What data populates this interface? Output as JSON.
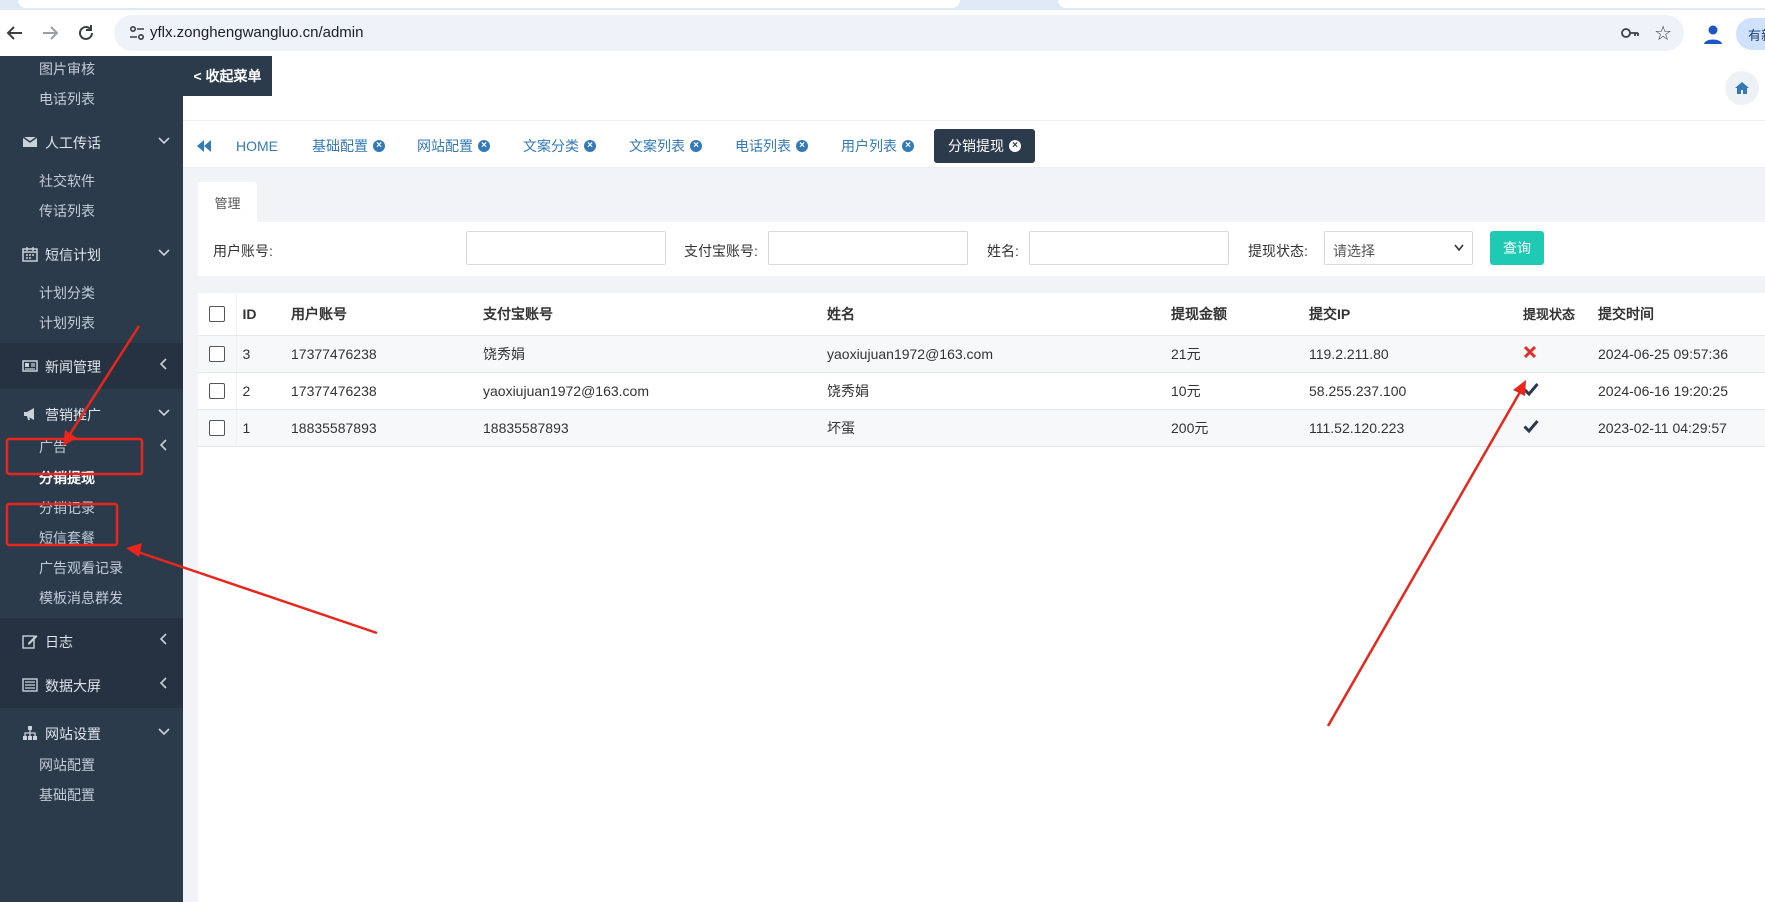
{
  "browser": {
    "url": "yflx.zonghengwangluo.cn/admin",
    "profile_text": "有新"
  },
  "sidebar": {
    "top_items": [
      "图片审核",
      "电话列表"
    ],
    "groups": [
      {
        "label": "人工传话",
        "icon": "envelope-icon",
        "expanded": true,
        "items": [
          "社交软件",
          "传话列表"
        ]
      },
      {
        "label": "短信计划",
        "icon": "calendar-icon",
        "expanded": true,
        "items": [
          "计划分类",
          "计划列表"
        ]
      },
      {
        "label": "新闻管理",
        "icon": "newspaper-icon",
        "expanded": false,
        "items": []
      },
      {
        "label": "营销推广",
        "icon": "bullhorn-icon",
        "expanded": true,
        "items": [
          "广告",
          "分销提现",
          "分销记录",
          "短信套餐",
          "广告观看记录",
          "模板消息群发"
        ]
      },
      {
        "label": "日志",
        "icon": "edit-icon",
        "expanded": false,
        "items": []
      },
      {
        "label": "数据大屏",
        "icon": "list-icon",
        "expanded": false,
        "items": []
      },
      {
        "label": "网站设置",
        "icon": "sitemap-icon",
        "expanded": true,
        "items": [
          "网站配置",
          "基础配置"
        ]
      }
    ],
    "active_item": "分销提现"
  },
  "header": {
    "collapse_label": "< 收起菜单"
  },
  "tabs": [
    {
      "label": "HOME",
      "closable": false
    },
    {
      "label": "基础配置",
      "closable": true
    },
    {
      "label": "网站配置",
      "closable": true
    },
    {
      "label": "文案分类",
      "closable": true
    },
    {
      "label": "文案列表",
      "closable": true
    },
    {
      "label": "电话列表",
      "closable": true
    },
    {
      "label": "用户列表",
      "closable": true
    },
    {
      "label": "分销提现",
      "closable": true,
      "active": true
    }
  ],
  "panel": {
    "tab_label": "管理"
  },
  "search": {
    "fields": [
      {
        "label": "用户账号:",
        "value": ""
      },
      {
        "label": "支付宝账号:",
        "value": ""
      },
      {
        "label": "姓名:",
        "value": ""
      }
    ],
    "status_label": "提现状态:",
    "status_value": "请选择",
    "submit_label": "查询"
  },
  "table": {
    "columns": [
      "ID",
      "用户账号",
      "支付宝账号",
      "姓名",
      "提现金额",
      "提交IP",
      "提现状态",
      "提交时间"
    ],
    "rows": [
      {
        "id": "3",
        "account": "17377476238",
        "alipay": "饶秀娟",
        "name": "yaoxiujuan1972@163.com",
        "amount": "21元",
        "ip": "119.2.211.80",
        "status": "rejected",
        "time": "2024-06-25 09:57:36"
      },
      {
        "id": "2",
        "account": "17377476238",
        "alipay": "yaoxiujuan1972@163.com",
        "name": "饶秀娟",
        "amount": "10元",
        "ip": "58.255.237.100",
        "status": "approved",
        "time": "2024-06-16 19:20:25"
      },
      {
        "id": "1",
        "account": "18835587893",
        "alipay": "18835587893",
        "name": "坏蛋",
        "amount": "200元",
        "ip": "111.52.120.223",
        "status": "approved",
        "time": "2023-02-11 04:29:57"
      }
    ]
  },
  "colors": {
    "sidebar_bg": "#2b3b4c",
    "link_blue": "#337ab7",
    "submit_teal": "#1fcab4",
    "reject_red": "#e0302b",
    "annotation_red": "#e8261c"
  }
}
